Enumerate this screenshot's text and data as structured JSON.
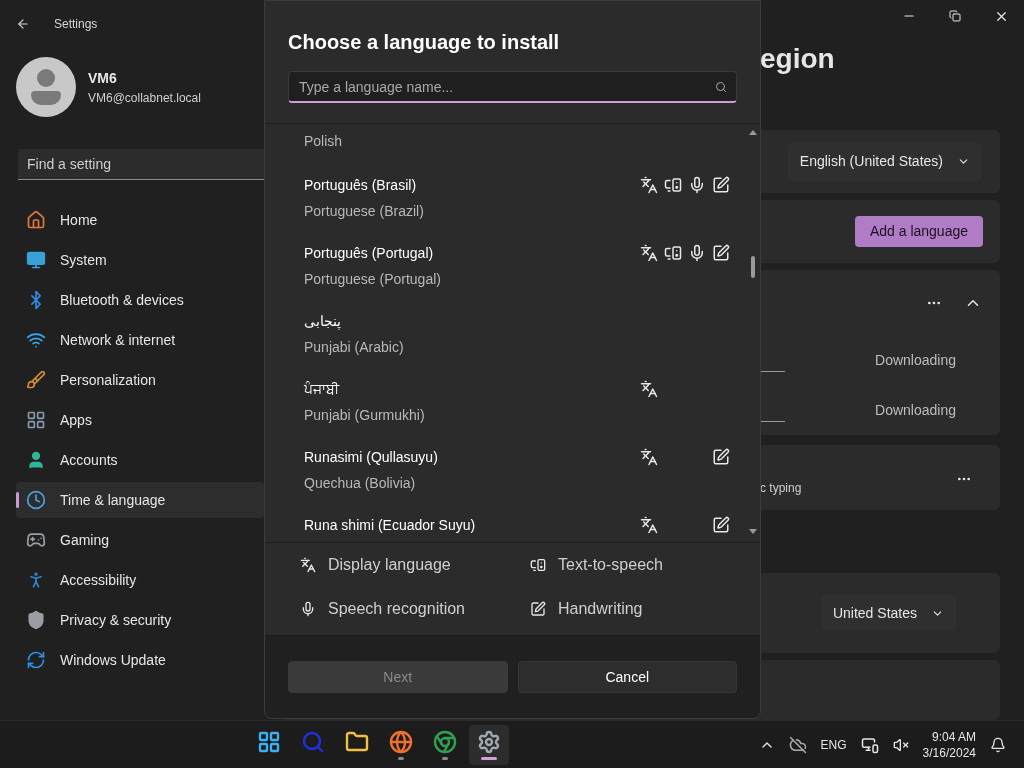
{
  "window": {
    "title": "Settings"
  },
  "user": {
    "name": "VM6",
    "email": "VM6@collabnet.local"
  },
  "search": {
    "placeholder": "Find a setting"
  },
  "nav": [
    {
      "label": "Home",
      "selected": false
    },
    {
      "label": "System",
      "selected": false
    },
    {
      "label": "Bluetooth & devices",
      "selected": false
    },
    {
      "label": "Network & internet",
      "selected": false
    },
    {
      "label": "Personalization",
      "selected": false
    },
    {
      "label": "Apps",
      "selected": false
    },
    {
      "label": "Accounts",
      "selected": false
    },
    {
      "label": "Time & language",
      "selected": true
    },
    {
      "label": "Gaming",
      "selected": false
    },
    {
      "label": "Accessibility",
      "selected": false
    },
    {
      "label": "Privacy & security",
      "selected": false
    },
    {
      "label": "Windows Update",
      "selected": false
    }
  ],
  "page": {
    "title": "egion",
    "display_language": "English (United States)",
    "add_button": "Add a language",
    "statuses": [
      "Downloading",
      "Downloading"
    ],
    "typing_note": "c typing",
    "region": "United States"
  },
  "dialog": {
    "title": "Choose a language to install",
    "search_placeholder": "Type a language name...",
    "languages": [
      {
        "english": "Polish",
        "display": false,
        "tts": false,
        "speech": false,
        "handwriting": false
      },
      {
        "native": "Português (Brasil)",
        "english": "Portuguese (Brazil)",
        "display": true,
        "tts": true,
        "speech": true,
        "handwriting": true
      },
      {
        "native": "Português (Portugal)",
        "english": "Portuguese (Portugal)",
        "display": true,
        "tts": true,
        "speech": true,
        "handwriting": true
      },
      {
        "native": "پنجابی",
        "english": "Punjabi (Arabic)",
        "display": false,
        "tts": false,
        "speech": false,
        "handwriting": false
      },
      {
        "native": "ਪੰਜਾਬੀ",
        "english": "Punjabi (Gurmukhi)",
        "display": true,
        "tts": false,
        "speech": false,
        "handwriting": false
      },
      {
        "native": "Runasimi (Qullasuyu)",
        "english": "Quechua (Bolivia)",
        "display": true,
        "tts": false,
        "speech": false,
        "handwriting": true
      },
      {
        "native": "Runa shimi (Ecuador Suyu)",
        "display": true,
        "tts": false,
        "speech": false,
        "handwriting": true
      }
    ],
    "legend": [
      {
        "kind": "display",
        "label": "Display language"
      },
      {
        "kind": "tts",
        "label": "Text-to-speech"
      },
      {
        "kind": "speech",
        "label": "Speech recognition"
      },
      {
        "kind": "handwriting",
        "label": "Handwriting"
      }
    ],
    "buttons": [
      {
        "label": "Next",
        "disabled": true
      },
      {
        "label": "Cancel",
        "disabled": false
      }
    ]
  },
  "taskbar": {
    "apps": [
      {
        "running": false,
        "selected": false
      },
      {
        "running": false,
        "selected": false
      },
      {
        "running": false,
        "selected": false
      },
      {
        "running": true,
        "selected": false
      },
      {
        "running": true,
        "selected": false
      },
      {
        "running": true,
        "selected": true
      }
    ],
    "language": "ENG",
    "time": "9:04 AM",
    "date": "3/16/2024"
  }
}
